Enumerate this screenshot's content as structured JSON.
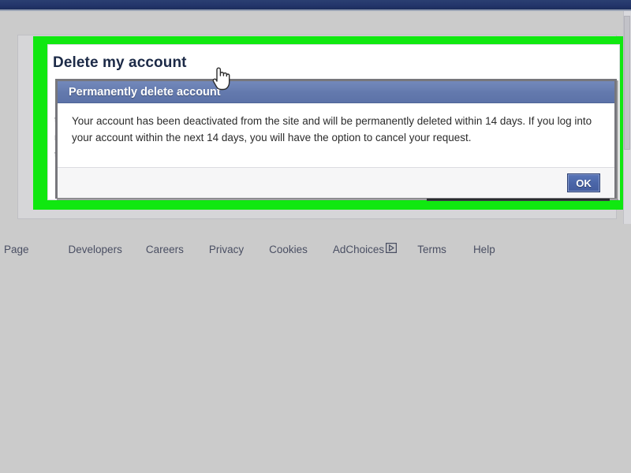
{
  "window": {
    "topbar_color": "#23356a",
    "page_background": "#cbcbcb",
    "highlight_color": "#10e810"
  },
  "panel": {
    "heading": "Delete my account",
    "occluded_lines": [
      "If",
      "th",
      "re",
      "ts",
      "e"
    ]
  },
  "modal": {
    "title": "Permanently delete account",
    "body": "Your account has been deactivated from the site and will be permanently deleted within 14 days. If you log into your account within the next 14 days, you will have the option to cancel your request.",
    "ok_label": "OK",
    "titlebar_color": "#6379ad",
    "ok_button_color": "#4b66a8"
  },
  "cursor": {
    "type": "pointer-hand-cursor"
  },
  "footer": {
    "links": [
      {
        "label": "Page",
        "icon": ""
      },
      {
        "label": "Developers",
        "icon": ""
      },
      {
        "label": "Careers",
        "icon": ""
      },
      {
        "label": "Privacy",
        "icon": ""
      },
      {
        "label": "Cookies",
        "icon": ""
      },
      {
        "label": "AdChoices",
        "icon": "adchoices-triangle-icon"
      },
      {
        "label": "Terms",
        "icon": ""
      },
      {
        "label": "Help",
        "icon": ""
      }
    ]
  }
}
